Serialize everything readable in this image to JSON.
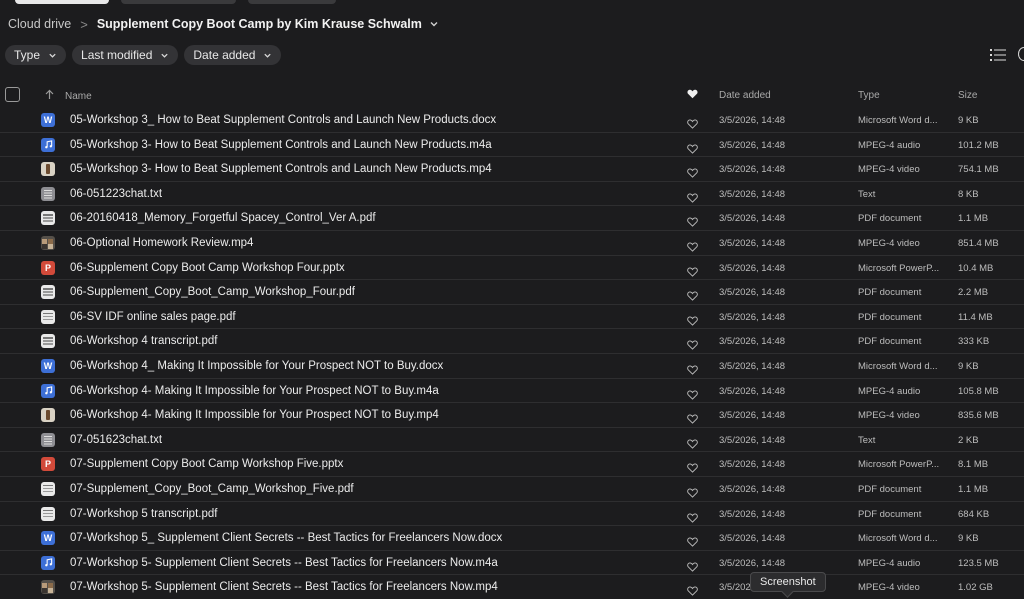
{
  "breadcrumb": {
    "root": "Cloud drive",
    "separator": ">",
    "current": "Supplement Copy Boot Camp by Kim Krause Schwalm"
  },
  "filters": [
    {
      "label": "Type"
    },
    {
      "label": "Last modified"
    },
    {
      "label": "Date added"
    }
  ],
  "header": {
    "name": "Name",
    "date_added": "Date added",
    "type": "Type",
    "size": "Size"
  },
  "files": [
    {
      "icon": "word-icon",
      "name": "05-Workshop 3_ How to Beat Supplement Controls and Launch New Products.docx",
      "date": "3/5/2026, 14:48",
      "type": "Microsoft Word d...",
      "size": "9 KB"
    },
    {
      "icon": "audio-icon",
      "name": "05-Workshop 3- How to Beat Supplement Controls and Launch New Products.m4a",
      "date": "3/5/2026, 14:48",
      "type": "MPEG-4 audio",
      "size": "101.2 MB"
    },
    {
      "icon": "video-icon",
      "name": "05-Workshop 3- How to Beat Supplement Controls and Launch New Products.mp4",
      "date": "3/5/2026, 14:48",
      "type": "MPEG-4 video",
      "size": "754.1 MB"
    },
    {
      "icon": "text-icon",
      "name": "06-051223chat.txt",
      "date": "3/5/2026, 14:48",
      "type": "Text",
      "size": "8 KB"
    },
    {
      "icon": "pdf-icon",
      "name": "06-20160418_Memory_Forgetful Spacey_Control_Ver A.pdf",
      "date": "3/5/2026, 14:48",
      "type": "PDF document",
      "size": "1.1 MB"
    },
    {
      "icon": "video-thumb-icon",
      "name": "06-Optional Homework Review.mp4",
      "date": "3/5/2026, 14:48",
      "type": "MPEG-4 video",
      "size": "851.4 MB"
    },
    {
      "icon": "powerpoint-icon",
      "name": "06-Supplement Copy Boot Camp Workshop Four.pptx",
      "date": "3/5/2026, 14:48",
      "type": "Microsoft PowerP...",
      "size": "10.4 MB"
    },
    {
      "icon": "pdf-icon",
      "name": "06-Supplement_Copy_Boot_Camp_Workshop_Four.pdf",
      "date": "3/5/2026, 14:48",
      "type": "PDF document",
      "size": "2.2 MB"
    },
    {
      "icon": "pdf-icon",
      "name": "06-SV IDF online sales page.pdf",
      "date": "3/5/2026, 14:48",
      "type": "PDF document",
      "size": "11.4 MB"
    },
    {
      "icon": "pdf-icon",
      "name": "06-Workshop 4 transcript.pdf",
      "date": "3/5/2026, 14:48",
      "type": "PDF document",
      "size": "333 KB"
    },
    {
      "icon": "word-icon",
      "name": "06-Workshop 4_ Making It Impossible for Your Prospect NOT to Buy.docx",
      "date": "3/5/2026, 14:48",
      "type": "Microsoft Word d...",
      "size": "9 KB"
    },
    {
      "icon": "audio-icon",
      "name": "06-Workshop 4- Making It Impossible for Your Prospect NOT to Buy.m4a",
      "date": "3/5/2026, 14:48",
      "type": "MPEG-4 audio",
      "size": "105.8 MB"
    },
    {
      "icon": "video-icon",
      "name": "06-Workshop 4- Making It Impossible for Your Prospect NOT to Buy.mp4",
      "date": "3/5/2026, 14:48",
      "type": "MPEG-4 video",
      "size": "835.6 MB"
    },
    {
      "icon": "text-icon",
      "name": "07-051623chat.txt",
      "date": "3/5/2026, 14:48",
      "type": "Text",
      "size": "2 KB"
    },
    {
      "icon": "powerpoint-icon",
      "name": "07-Supplement Copy Boot Camp Workshop Five.pptx",
      "date": "3/5/2026, 14:48",
      "type": "Microsoft PowerP...",
      "size": "8.1 MB"
    },
    {
      "icon": "pdf-icon",
      "name": "07-Supplement_Copy_Boot_Camp_Workshop_Five.pdf",
      "date": "3/5/2026, 14:48",
      "type": "PDF document",
      "size": "1.1 MB"
    },
    {
      "icon": "pdf-icon",
      "name": "07-Workshop 5 transcript.pdf",
      "date": "3/5/2026, 14:48",
      "type": "PDF document",
      "size": "684 KB"
    },
    {
      "icon": "word-icon",
      "name": "07-Workshop 5_ Supplement Client Secrets -- Best Tactics for Freelancers Now.docx",
      "date": "3/5/2026, 14:48",
      "type": "Microsoft Word d...",
      "size": "9 KB"
    },
    {
      "icon": "audio-icon",
      "name": "07-Workshop 5- Supplement Client Secrets -- Best Tactics for Freelancers Now.m4a",
      "date": "3/5/2026, 14:48",
      "type": "MPEG-4 audio",
      "size": "123.5 MB"
    },
    {
      "icon": "video-thumb-icon",
      "name": "07-Workshop 5- Supplement Client Secrets -- Best Tactics for Freelancers Now.mp4",
      "date": "3/5/2026, 14:48",
      "type": "MPEG-4 video",
      "size": "1.02 GB"
    }
  ],
  "tooltip": "Screenshot",
  "colors": {
    "background": "#1c1c1e",
    "chip": "#333336",
    "word": "#3d6fd6",
    "powerpoint": "#d24a3a"
  }
}
